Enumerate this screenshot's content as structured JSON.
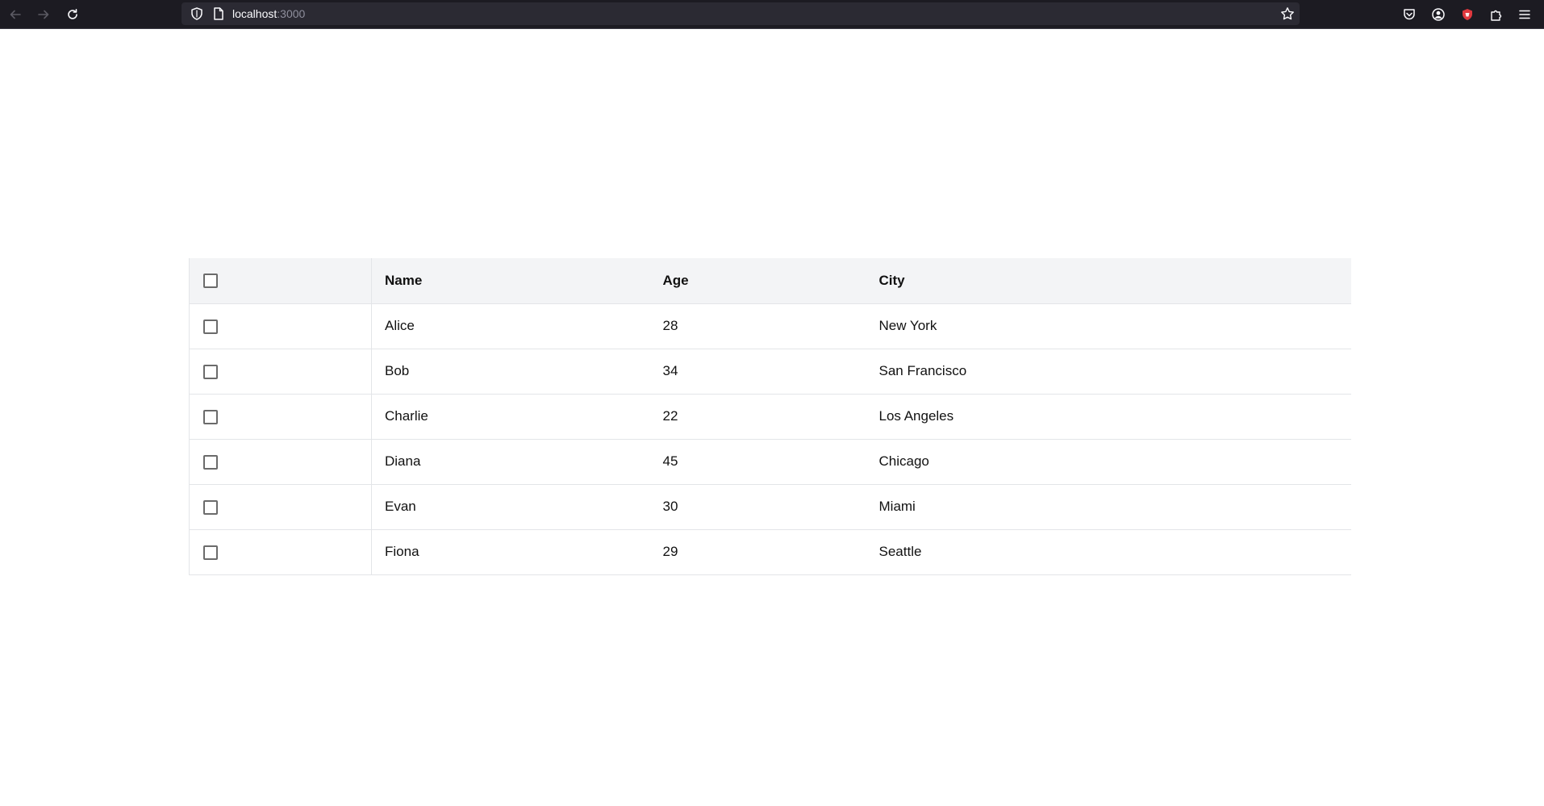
{
  "browser": {
    "url_host": "localhost",
    "url_port": ":3000"
  },
  "table": {
    "columns": [
      "Name",
      "Age",
      "City"
    ],
    "rows": [
      {
        "name": "Alice",
        "age": "28",
        "city": "New York"
      },
      {
        "name": "Bob",
        "age": "34",
        "city": "San Francisco"
      },
      {
        "name": "Charlie",
        "age": "22",
        "city": "Los Angeles"
      },
      {
        "name": "Diana",
        "age": "45",
        "city": "Chicago"
      },
      {
        "name": "Evan",
        "age": "30",
        "city": "Miami"
      },
      {
        "name": "Fiona",
        "age": "29",
        "city": "Seattle"
      }
    ]
  },
  "icons": {
    "back": "arrow-left-icon",
    "forward": "arrow-right-icon",
    "reload": "reload-icon",
    "shield": "shield-icon",
    "page": "page-icon",
    "star": "star-icon",
    "pocket": "pocket-icon",
    "account": "account-icon",
    "extension_red": "extension-badge-icon",
    "extensions": "puzzle-icon",
    "menu": "hamburger-menu-icon"
  },
  "colors": {
    "chrome_bg": "#1c1b22",
    "url_bg": "#2b2a33",
    "header_row_bg": "#f3f4f6",
    "border": "#e3e5e8",
    "text": "#111111"
  }
}
